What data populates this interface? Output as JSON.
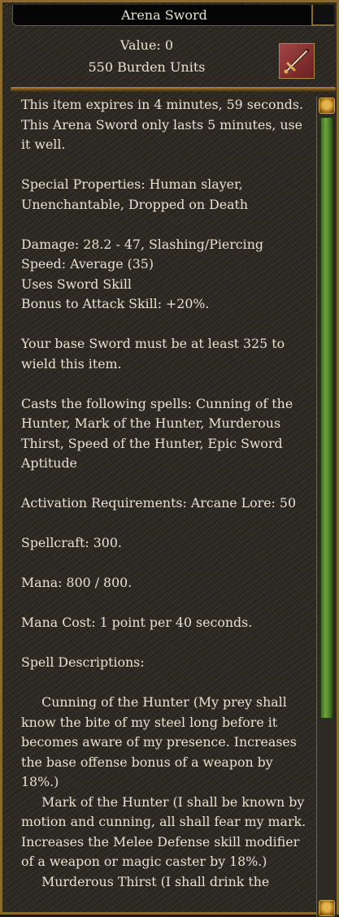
{
  "window": {
    "title": "Arena Sword"
  },
  "item": {
    "value": "Value: 0",
    "burden": "550 Burden Units",
    "icon": "sword-icon"
  },
  "content": {
    "paragraphs": [
      "This item expires in 4 minutes, 59 seconds. This Arena Sword only lasts 5 minutes, use it well.\n ",
      "Special Properties: Human slayer, Unenchantable, Dropped on Death\n ",
      "Damage: 28.2 - 47, Slashing/Piercing\nSpeed: Average (35)\nUses Sword Skill\nBonus to Attack Skill: +20%.\n ",
      "Your base Sword must be at least 325 to wield this item.\n ",
      "Casts the following spells: Cunning of the Hunter, Mark of the Hunter, Murderous Thirst, Speed of the Hunter, Epic Sword Aptitude\n ",
      "Activation Requirements: Arcane Lore: 50\n ",
      "Spellcraft: 300.\n ",
      "Mana: 800 / 800.\n ",
      "Mana Cost: 1 point per 40 seconds.\n ",
      "Spell Descriptions:\n ",
      "     Cunning of the Hunter (My prey shall know the bite of my steel long before it becomes aware of my presence. Increases the base offense bonus of a weapon by 18%.)",
      "     Mark of the Hunter (I shall be known by motion and cunning, all shall fear my mark. Increases the Melee Defense skill modifier of a weapon or magic caster by 18%.)",
      "     Murderous Thirst (I shall drink the"
    ]
  },
  "colors": {
    "text": "#e8e2d2",
    "border_gold": "#8a6a2a",
    "scroll_thumb": "#6fa33b",
    "scroll_arrow": "#e3b54a"
  }
}
